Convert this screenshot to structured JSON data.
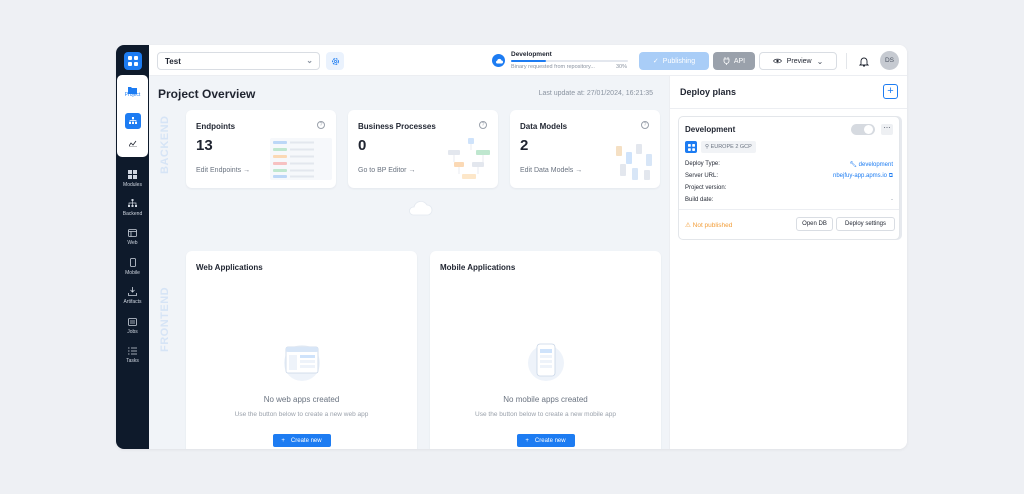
{
  "sidebar": {
    "project_label": "Project",
    "items": [
      {
        "label": "Modules",
        "icon": "modules-icon"
      },
      {
        "label": "Backend",
        "icon": "backend-icon"
      },
      {
        "label": "Web",
        "icon": "web-icon"
      },
      {
        "label": "Mobile",
        "icon": "mobile-icon"
      },
      {
        "label": "Artifacts",
        "icon": "artifacts-icon"
      },
      {
        "label": "Jobs",
        "icon": "jobs-icon"
      },
      {
        "label": "Tasks",
        "icon": "tasks-icon"
      }
    ]
  },
  "topbar": {
    "project_name": "Test",
    "status_title": "Development",
    "status_text": "Binary requested from repository...",
    "status_percent": "30%",
    "status_progress": 0.3,
    "publish_label": "Publishing",
    "api_label": "API",
    "preview_label": "Preview",
    "avatar_initials": "DS"
  },
  "main": {
    "title": "Project Overview",
    "last_update": "Last update at: 27/01/2024, 16:21:35",
    "backend_label": "BACKEND",
    "frontend_label": "FRONTEND",
    "cards": [
      {
        "title": "Endpoints",
        "value": "13",
        "link": "Edit Endpoints →"
      },
      {
        "title": "Business Processes",
        "value": "0",
        "link": "Go to BP Editor →"
      },
      {
        "title": "Data Models",
        "value": "2",
        "link": "Edit Data Models →"
      }
    ],
    "web": {
      "title": "Web Applications",
      "empty_title": "No web apps created",
      "empty_text": "Use the button below to create a new web app",
      "button": "Create new"
    },
    "mobile": {
      "title": "Mobile Applications",
      "empty_title": "No mobile apps created",
      "empty_text": "Use the button below to create a new mobile app",
      "button": "Create new"
    }
  },
  "deploy": {
    "title": "Deploy plans",
    "plan": {
      "name": "Development",
      "region": "EUROPE 2 GCP",
      "rows": [
        {
          "label": "Deploy Type:",
          "value": "development"
        },
        {
          "label": "Server URL:",
          "value": "nbejfuy-app.apms.io"
        },
        {
          "label": "Project version:",
          "value": ""
        },
        {
          "label": "Build date:",
          "value": "-"
        }
      ],
      "status": "Not published",
      "open_db": "Open DB",
      "deploy_settings": "Deploy settings"
    }
  },
  "colors": {
    "accent": "#1d7cf2",
    "sidebar": "#0e1a2b",
    "warning": "#f29d38"
  }
}
